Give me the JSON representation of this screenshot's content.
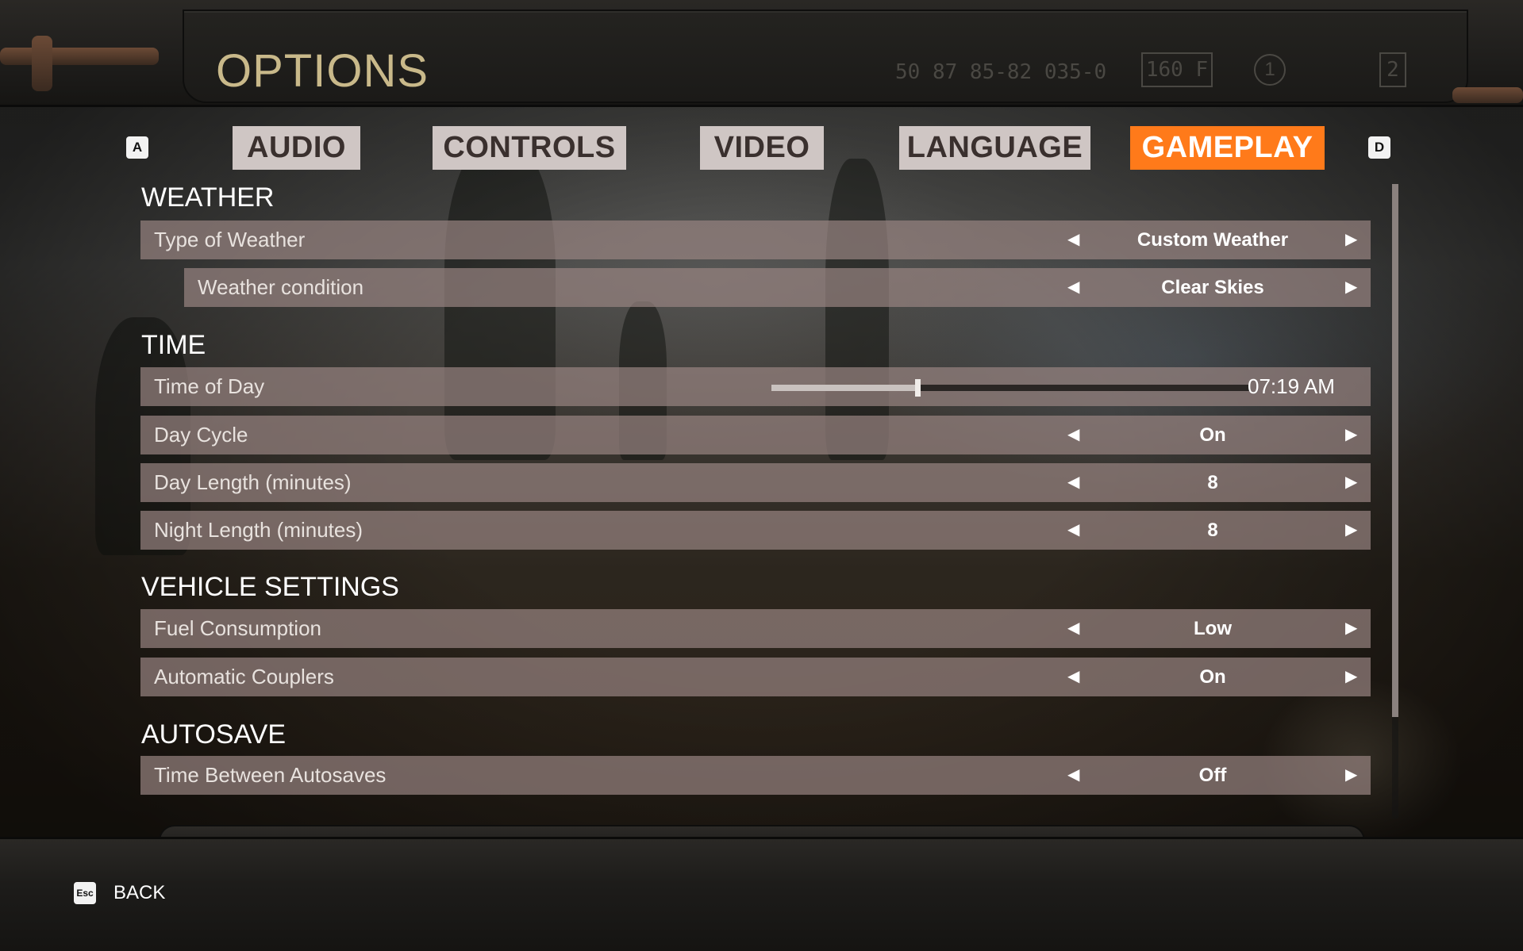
{
  "header": {
    "title": "OPTIONS",
    "serial": "50 87 85-82 035-0",
    "plate_text": "160 F",
    "circle_1": "1",
    "circle_2": "2"
  },
  "tabs": {
    "prev_key": "A",
    "next_key": "D",
    "items": [
      {
        "label": "AUDIO",
        "active": false
      },
      {
        "label": "CONTROLS",
        "active": false
      },
      {
        "label": "VIDEO",
        "active": false
      },
      {
        "label": "LANGUAGE",
        "active": false
      },
      {
        "label": "GAMEPLAY",
        "active": true
      }
    ],
    "active_color": "#ff7a1a"
  },
  "sections": {
    "weather": {
      "title": "WEATHER",
      "type_of_weather": {
        "label": "Type of Weather",
        "value": "Custom Weather"
      },
      "weather_condition": {
        "label": "Weather condition",
        "value": "Clear Skies"
      }
    },
    "time": {
      "title": "TIME",
      "time_of_day": {
        "label": "Time of Day",
        "value": "07:19 AM",
        "slider_fraction": 0.305
      },
      "day_cycle": {
        "label": "Day Cycle",
        "value": "On"
      },
      "day_length": {
        "label": "Day Length (minutes)",
        "value": "8"
      },
      "night_length": {
        "label": "Night Length (minutes)",
        "value": "8"
      }
    },
    "vehicle": {
      "title": "VEHICLE SETTINGS",
      "fuel_consumption": {
        "label": "Fuel Consumption",
        "value": "Low"
      },
      "automatic_couplers": {
        "label": "Automatic Couplers",
        "value": "On"
      }
    },
    "autosave": {
      "title": "AUTOSAVE",
      "time_between_autosaves": {
        "label": "Time Between Autosaves",
        "value": "Off"
      }
    }
  },
  "arrows": {
    "left": "◀",
    "right": "▶"
  },
  "footer": {
    "esc_key": "Esc",
    "back_label": "BACK"
  }
}
